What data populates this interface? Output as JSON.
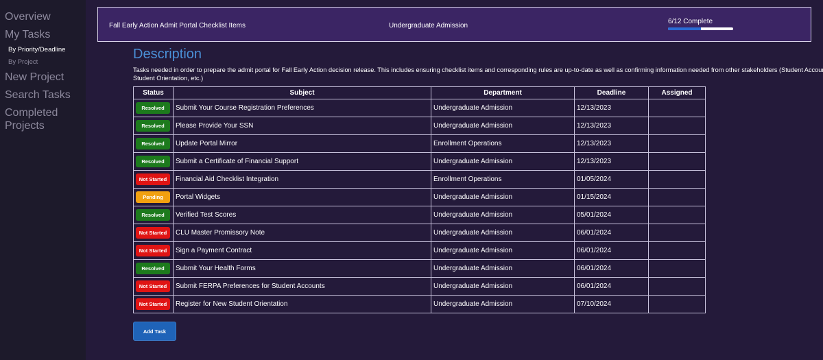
{
  "sidebar": {
    "items": [
      {
        "label": "Overview"
      },
      {
        "label": "My Tasks"
      },
      {
        "label": "By Priority/Deadline"
      },
      {
        "label": "By Project"
      },
      {
        "label": "New Project"
      },
      {
        "label": "Search Tasks"
      },
      {
        "label": "Completed Projects"
      }
    ]
  },
  "header": {
    "title": "Fall Early Action Admit Portal Checklist Items",
    "department": "Undergraduate Admission",
    "progress_label": "6/12 Complete",
    "progress_fraction": 0.5,
    "progress_color": "#2a6ad4"
  },
  "description": {
    "heading": "Description",
    "text": "Tasks needed in order to prepare the admit portal for Fall Early Action decision release. This includes ensuring checklist items and corresponding rules are up-to-date as well as confirming information needed from other stakeholders (Student Accounts, Financial Aid, New Student Orientation, etc.)"
  },
  "table": {
    "headers": {
      "status": "Status",
      "subject": "Subject",
      "department": "Department",
      "deadline": "Deadline",
      "assigned": "Assigned"
    },
    "rows": [
      {
        "status": "Resolved",
        "subject": "Submit Your Course Registration Preferences",
        "department": "Undergraduate Admission",
        "deadline": "12/13/2023",
        "assigned": ""
      },
      {
        "status": "Resolved",
        "subject": "Please Provide Your SSN",
        "department": "Undergraduate Admission",
        "deadline": "12/13/2023",
        "assigned": ""
      },
      {
        "status": "Resolved",
        "subject": "Update Portal Mirror",
        "department": "Enrollment Operations",
        "deadline": "12/13/2023",
        "assigned": ""
      },
      {
        "status": "Resolved",
        "subject": "Submit a Certificate of Financial Support",
        "department": "Undergraduate Admission",
        "deadline": "12/13/2023",
        "assigned": ""
      },
      {
        "status": "Not Started",
        "subject": "Financial Aid Checklist Integration",
        "department": "Enrollment Operations",
        "deadline": "01/05/2024",
        "assigned": ""
      },
      {
        "status": "Pending",
        "subject": "Portal Widgets",
        "department": "Undergraduate Admission",
        "deadline": "01/15/2024",
        "assigned": ""
      },
      {
        "status": "Resolved",
        "subject": "Verified Test Scores",
        "department": "Undergraduate Admission",
        "deadline": "05/01/2024",
        "assigned": ""
      },
      {
        "status": "Not Started",
        "subject": "CLU Master Promissory Note",
        "department": "Undergraduate Admission",
        "deadline": "06/01/2024",
        "assigned": ""
      },
      {
        "status": "Not Started",
        "subject": "Sign a Payment Contract",
        "department": "Undergraduate Admission",
        "deadline": "06/01/2024",
        "assigned": ""
      },
      {
        "status": "Resolved",
        "subject": "Submit Your Health Forms",
        "department": "Undergraduate Admission",
        "deadline": "06/01/2024",
        "assigned": ""
      },
      {
        "status": "Not Started",
        "subject": "Submit FERPA Preferences for Student Accounts",
        "department": "Undergraduate Admission",
        "deadline": "06/01/2024",
        "assigned": ""
      },
      {
        "status": "Not Started",
        "subject": "Register for New Student Orientation",
        "department": "Undergraduate Admission",
        "deadline": "07/10/2024",
        "assigned": ""
      }
    ]
  },
  "status_colors": {
    "Resolved": "#1d7a1d",
    "Not Started": "#e01414",
    "Pending": "#f2a010"
  },
  "add_task_label": "Add Task"
}
